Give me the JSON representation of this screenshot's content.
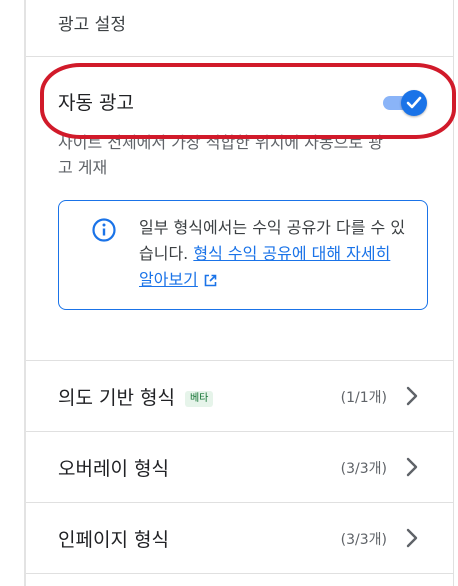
{
  "section": {
    "title": "광고 설정"
  },
  "auto_ads": {
    "title": "자동 광고",
    "enabled": true,
    "description": "사이트 전체에서 가장 적합한 위치에 자동으로 광고 게재"
  },
  "info_box": {
    "text": "일부 형식에서는 수익 공유가 다를 수 있습니다.",
    "link_text": "형식 수익 공유에 대해 자세히 알아보기",
    "icon": "info-icon",
    "link_icon": "open-in-new-icon"
  },
  "formats": [
    {
      "label": "의도 기반 형식",
      "badge": "베타",
      "count": "(1/1개)"
    },
    {
      "label": "오버레이 형식",
      "badge": "",
      "count": "(3/3개)"
    },
    {
      "label": "인페이지 형식",
      "badge": "",
      "count": "(3/3개)"
    }
  ],
  "colors": {
    "accent": "#1a73e8",
    "annotation": "#d11a2a",
    "badge_text": "#137333",
    "badge_bg": "#e6f4ea"
  }
}
